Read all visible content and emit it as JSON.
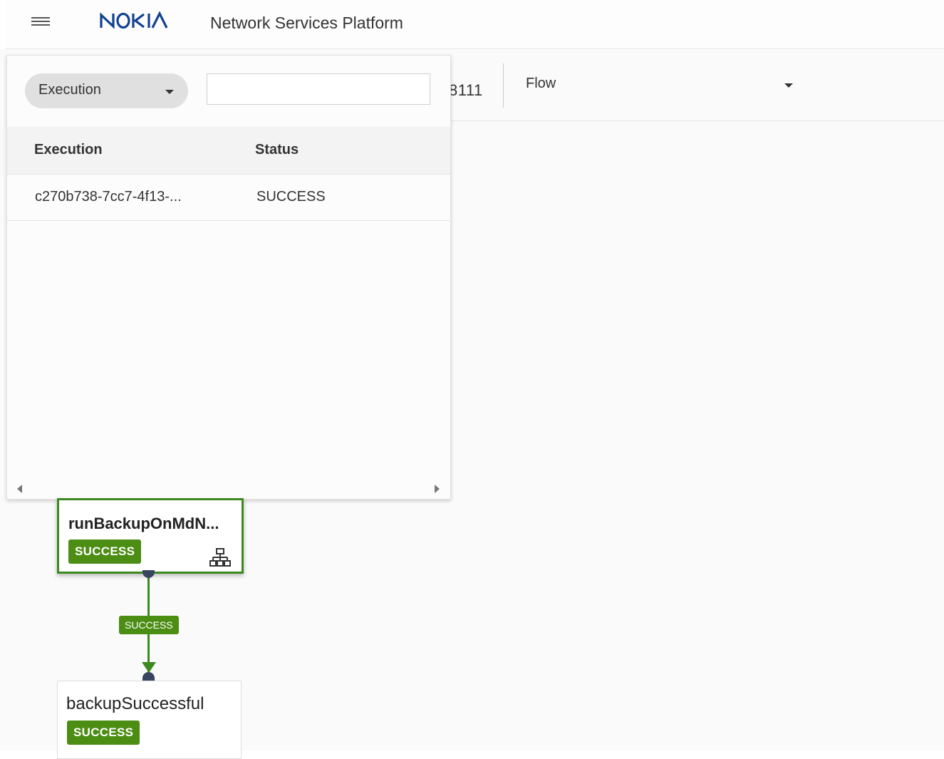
{
  "header": {
    "brand": "NOKIA",
    "app_title": "Network Services Platform"
  },
  "subbar": {
    "id_fragment": "8111",
    "view_select_value": "Flow"
  },
  "execution_panel": {
    "filter_select_value": "Execution",
    "search_value": "",
    "columns": [
      "Execution",
      "Status"
    ],
    "rows": [
      {
        "execution": "c270b738-7cc7-4f13-...",
        "status": "SUCCESS"
      }
    ]
  },
  "flow": {
    "nodes": [
      {
        "name": "runBackupOnMdN...",
        "status": "SUCCESS",
        "icon": "hierarchy-icon"
      },
      {
        "name": "backupSuccessful",
        "status": "SUCCESS"
      }
    ],
    "edges": [
      {
        "label": "SUCCESS"
      }
    ]
  },
  "colors": {
    "brand": "#124191",
    "success": "#4c8d14",
    "success_border": "#3c8a1f",
    "edge_port": "#37455e"
  }
}
